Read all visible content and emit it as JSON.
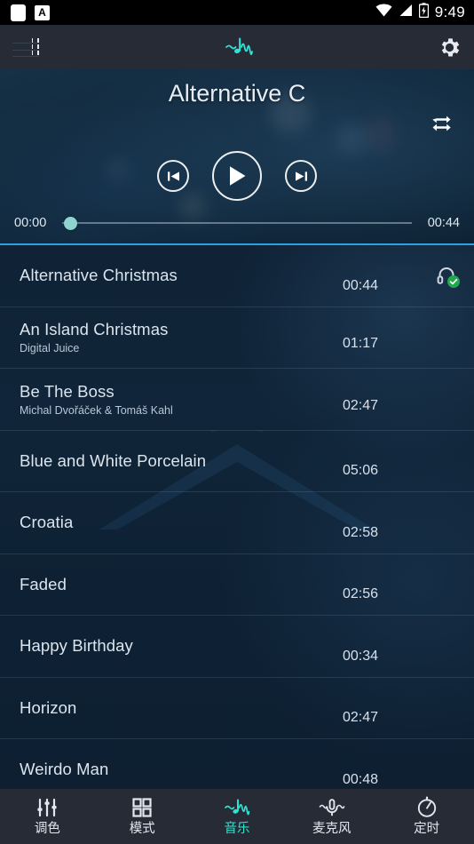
{
  "status_bar": {
    "time": "9:49",
    "left_icons": [
      "blank-app-icon",
      "keyboard-a-icon"
    ],
    "right_icons": [
      "wifi-icon",
      "cellular-signal-icon",
      "battery-charging-icon"
    ]
  },
  "app_bar": {
    "playlist_icon": "playlist-list-icon",
    "brand_icon": "music-wave-icon",
    "settings_icon": "gear-icon"
  },
  "player": {
    "now_playing_title": "Alternative C",
    "repeat_icon": "repeat-icon",
    "previous_icon": "skip-previous-icon",
    "play_icon": "play-icon",
    "next_icon": "skip-next-icon",
    "elapsed": "00:00",
    "total": "00:44",
    "progress_percent": 0,
    "thumb_color": "#8fd3cf"
  },
  "playlist": {
    "rows": [
      {
        "title": "Alternative Christmas",
        "artist": "",
        "duration": "00:44",
        "badge": "headphones-check-icon"
      },
      {
        "title": "An Island Christmas",
        "artist": "Digital Juice",
        "duration": "01:17",
        "badge": ""
      },
      {
        "title": "Be The Boss",
        "artist": "Michal Dvořáček & Tomáš Kahl",
        "duration": "02:47",
        "badge": ""
      },
      {
        "title": "Blue and White Porcelain",
        "artist": "",
        "duration": "05:06",
        "badge": ""
      },
      {
        "title": "Croatia",
        "artist": "",
        "duration": "02:58",
        "badge": ""
      },
      {
        "title": "Faded",
        "artist": "",
        "duration": "02:56",
        "badge": ""
      },
      {
        "title": "Happy Birthday",
        "artist": "",
        "duration": "00:34",
        "badge": ""
      },
      {
        "title": "Horizon",
        "artist": "",
        "duration": "02:47",
        "badge": ""
      },
      {
        "title": "Weirdo Man",
        "artist": "",
        "duration": "00:48",
        "badge": ""
      }
    ]
  },
  "bottom_nav": {
    "active_color": "#2ee3d2",
    "inactive_color": "#e3e7ee",
    "items": [
      {
        "label": "调色",
        "icon": "equalizer-icon",
        "active": false
      },
      {
        "label": "模式",
        "icon": "grid-modes-icon",
        "active": false
      },
      {
        "label": "音乐",
        "icon": "music-wave-icon",
        "active": true
      },
      {
        "label": "麦克风",
        "icon": "microphone-icon",
        "active": false
      },
      {
        "label": "定时",
        "icon": "timer-icon",
        "active": false
      }
    ]
  },
  "theme": {
    "status_bar_bg": "#000000",
    "app_bar_bg": "#262b36",
    "hero_bg": "#10283c",
    "list_bg": "#102539",
    "accent": "#2ee3d2",
    "list_top_border": "#2e9fe0"
  }
}
